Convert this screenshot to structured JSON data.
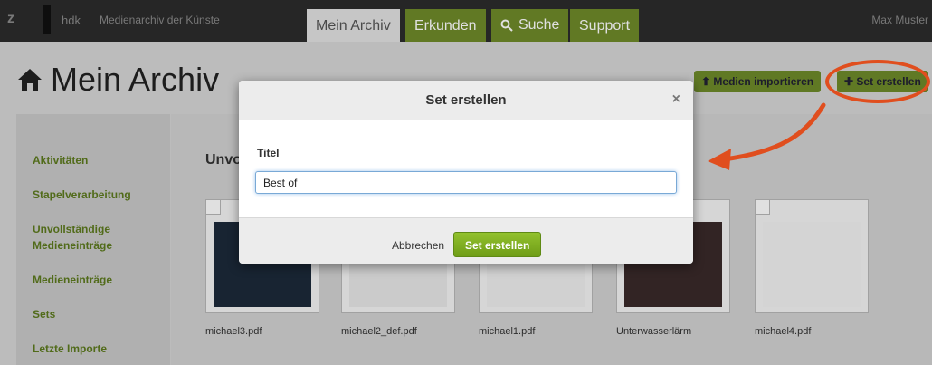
{
  "topbar": {
    "logo": "z",
    "brand": "hdk",
    "brand_sub": "Medienarchiv der Künste",
    "tabs": [
      {
        "label": "Mein Archiv"
      },
      {
        "label": "Erkunden"
      },
      {
        "label": "Suche"
      },
      {
        "label": "Support"
      }
    ],
    "user": "Max Muster"
  },
  "page": {
    "title": "Mein Archiv",
    "import_label": "Medien importieren",
    "create_set_label": "Set erstellen"
  },
  "sidebar": {
    "items": [
      {
        "label": "Aktivitäten"
      },
      {
        "label": "Stapelverarbeitung"
      },
      {
        "label": "Unvollständige Medieneinträge"
      },
      {
        "label": "Medieneinträge"
      },
      {
        "label": "Sets"
      },
      {
        "label": "Letzte Importe"
      }
    ]
  },
  "main": {
    "section_title": "Unvo",
    "files": [
      {
        "name": "michael3.pdf"
      },
      {
        "name": "michael2_def.pdf"
      },
      {
        "name": "michael1.pdf"
      },
      {
        "name": "Unterwasserlärm"
      },
      {
        "name": "michael4.pdf"
      }
    ]
  },
  "dialog": {
    "title": "Set erstellen",
    "close_label": "×",
    "field_label": "Titel",
    "field_value": "Best of",
    "cancel_label": "Abbrechen",
    "submit_label": "Set erstellen"
  },
  "colors": {
    "accent_green": "#7cac1e",
    "annotation_orange": "#e04e1e",
    "topbar": "#2c2c2c"
  }
}
